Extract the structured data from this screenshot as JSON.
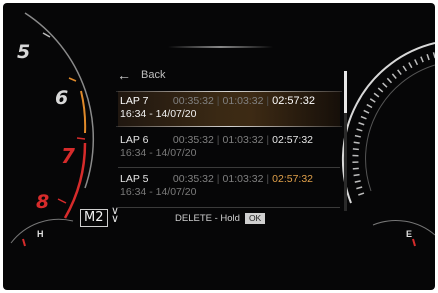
{
  "gauges": {
    "left_numbers": [
      "5",
      "6",
      "7",
      "8"
    ],
    "left_label": "H",
    "right_label": "E"
  },
  "menu": {
    "back_label": "Back",
    "laps": [
      {
        "name": "LAP 7",
        "time1": "00:35:32",
        "time2": "01:03:32",
        "total": "02:57:32",
        "date": "16:34 - 14/07/20",
        "selected": true,
        "best": false
      },
      {
        "name": "LAP 6",
        "time1": "00:35:32",
        "time2": "01:03:32",
        "total": "02:57:32",
        "date": "16:34 - 14/07/20",
        "selected": false,
        "best": false
      },
      {
        "name": "LAP 5",
        "time1": "00:35:32",
        "time2": "01:03:32",
        "total": "02:57:32",
        "date": "16:34 - 14/07/20",
        "selected": false,
        "best": true
      }
    ],
    "separator": "|"
  },
  "footer": {
    "gear": "M2",
    "delete_label": "DELETE - Hold",
    "ok_label": "OK"
  },
  "colors": {
    "redline": "#d62b2b",
    "best_time": "#e0a04a",
    "orange_arc": "#e08a2a"
  }
}
